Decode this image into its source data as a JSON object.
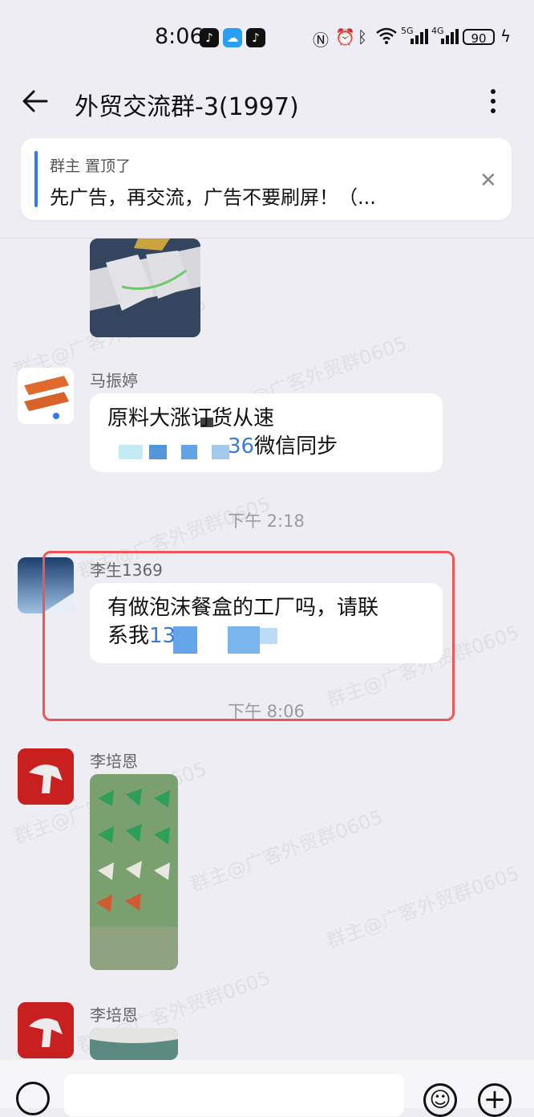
{
  "status_bar": {
    "time": "8:06",
    "battery": "90",
    "signal_labels": [
      "5G",
      "4G"
    ],
    "icons": [
      "tiktok-icon",
      "weather-icon",
      "tiktok-icon",
      "nfc-icon",
      "alarm-icon",
      "bluetooth-icon",
      "wifi-icon",
      "signal-5g-icon",
      "signal-4g-icon",
      "charging-icon"
    ]
  },
  "header": {
    "title": "外贸交流群-3(1997)"
  },
  "pinned": {
    "meta": "群主 置顶了",
    "text": "先广告，再交流，广告不要刷屏！（..."
  },
  "messages": [
    {
      "sender": "马振婷",
      "line1": "原料大涨订货从速",
      "line2_num": "36",
      "line2_text": "微信同步"
    },
    {
      "timestamp": "下午 2:18"
    },
    {
      "sender": "李生1369",
      "line1": "有做泡沫餐盒的工厂吗，请联",
      "line2_text": "系我",
      "line2_num": "13"
    },
    {
      "timestamp": "下午 8:06"
    },
    {
      "sender": "李培恩"
    },
    {
      "sender": "李培恩"
    }
  ],
  "watermark_text": "群主@广客外贸群0605",
  "colors": {
    "accent": "#2d7ee8",
    "highlight": "#f05555",
    "background": "#ededf3"
  }
}
